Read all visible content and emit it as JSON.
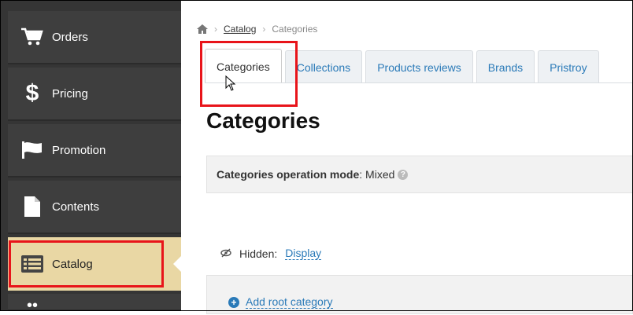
{
  "sidebar": {
    "items": [
      {
        "label": "Orders",
        "icon": "cart-icon"
      },
      {
        "label": "Pricing",
        "icon": "dollar-icon"
      },
      {
        "label": "Promotion",
        "icon": "flag-icon"
      },
      {
        "label": "Contents",
        "icon": "document-icon"
      },
      {
        "label": "Catalog",
        "icon": "list-icon",
        "active": true
      }
    ]
  },
  "breadcrumb": {
    "home_icon": "home-icon",
    "catalog": "Catalog",
    "current": "Categories"
  },
  "tabs": [
    {
      "label": "Categories",
      "active": true
    },
    {
      "label": "Collections"
    },
    {
      "label": "Products reviews"
    },
    {
      "label": "Brands"
    },
    {
      "label": "Pristroy"
    }
  ],
  "page": {
    "title": "Categories",
    "mode_label": "Categories operation mode",
    "mode_value": "Mixed",
    "hidden_label": "Hidden:",
    "hidden_action": "Display",
    "add_root": "Add root category"
  },
  "colors": {
    "sidebar_bg": "#353535",
    "active_item_bg": "#e9d7a4",
    "link": "#2a7ab8",
    "highlight": "#e8141a"
  }
}
